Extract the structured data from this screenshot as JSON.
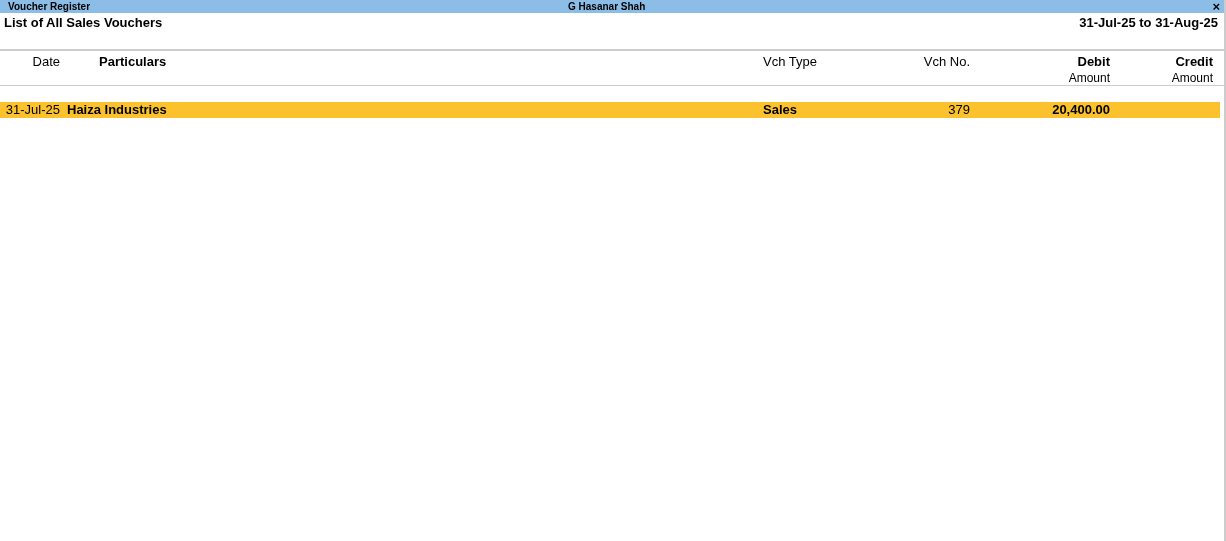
{
  "window": {
    "title": "Voucher Register",
    "company": "G Hasanar Shah",
    "close": "×"
  },
  "report": {
    "title": "List of All Sales Vouchers",
    "period": "31-Jul-25 to 31-Aug-25"
  },
  "table": {
    "columns": [
      {
        "kind": "date",
        "lines": [
          "Date"
        ]
      },
      {
        "kind": "particulars",
        "lines": [
          "Particulars"
        ]
      },
      {
        "kind": "type",
        "lines": [
          "Vch Type"
        ]
      },
      {
        "kind": "number",
        "lines": [
          "Vch No."
        ]
      },
      {
        "kind": "amount",
        "lines": [
          "Debit",
          "Amount"
        ]
      },
      {
        "kind": "amount",
        "lines": [
          "Credit",
          "Amount"
        ]
      }
    ],
    "rows": [
      {
        "selected": true,
        "cells": [
          "31-Jul-25",
          "Haiza Industries",
          "Sales",
          "379",
          "20,400.00",
          ""
        ]
      }
    ]
  }
}
